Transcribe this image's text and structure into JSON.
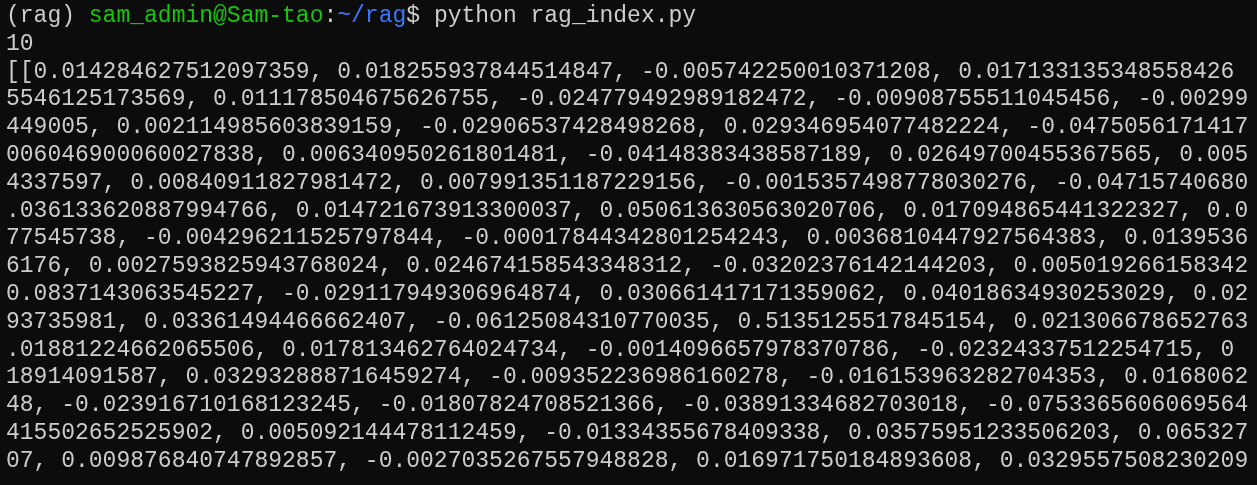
{
  "prompt": {
    "env": "(rag)",
    "user_host": "sam_admin@Sam-tao",
    "separator": ":",
    "path": "~/rag",
    "symbol": "$",
    "command": "python rag_index.py"
  },
  "output_lines": [
    "10",
    "[[0.014284627512097359, 0.018255937844514847, -0.005742250010371208, 0.017133135348558426",
    "5546125173569, 0.011178504675626755, -0.024779492989182472, -0.00908755511045456, -0.00299",
    "449005, 0.002114985603839159, -0.02906537428498268, 0.029346954077482224, -0.0475056171417",
    "006046900060027838, 0.006340950261801481, -0.04148383438587189, 0.02649700455367565, 0.005",
    "4337597, 0.00840911827981472, 0.007991351187229156, -0.0015357498778030276, -0.04715740680",
    ".036133620887994766, 0.014721673913300037, 0.050613630563020706, 0.017094865441322327, 0.0",
    "77545738, -0.004296211525797844, -0.00017844342801254243, 0.0036810447927564383, 0.0139536",
    "6176, 0.0027593825943768024, 0.024674158543348312, -0.03202376142144203, 0.005019266158342",
    "0.0837143063545227, -0.029117949306964874, 0.030661417171359062, 0.04018634930253029, 0.02",
    "93735981, 0.03361494466662407, -0.06125084310770035, 0.5135125517845154, 0.021306678652763",
    ".01881224662065506, 0.017813462764024734, -0.0014096657978370786, -0.02324337512254715, 0",
    "18914091587, 0.032932888716459274, -0.009352236986160278, -0.016153963282704353, 0.0168062",
    "48, -0.023916710168123245, -0.01807824708521366, -0.03891334682703018, -0.0753365606069564",
    "415502652525902, 0.005092144478112459, -0.01334355678409338, 0.03575951233506203, 0.065327",
    "07, 0.009876840747892857, -0.0027035267557948828, 0.016971750184893608, 0.0329557508230209"
  ]
}
